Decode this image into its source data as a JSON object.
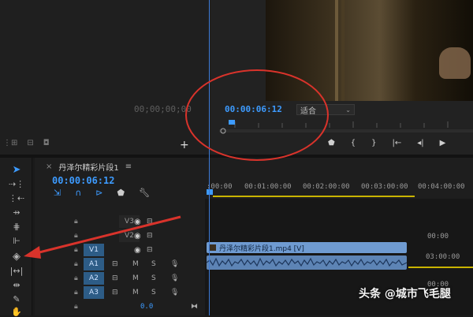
{
  "source": {
    "timecode": "00;00;00;00"
  },
  "program": {
    "timecode": "00:00:06:12",
    "fit_label": "适合"
  },
  "timeline": {
    "sequence_name": "丹泽尔精彩片段1",
    "timecode": "00:00:06:12",
    "ruler_labels": [
      ":00:00",
      "00:01:00:00",
      "00:02:00:00",
      "00:03:00:00",
      "00:04:00:00"
    ],
    "tracks": [
      {
        "name": "V3",
        "type": "video"
      },
      {
        "name": "V2",
        "type": "video"
      },
      {
        "name": "V1",
        "type": "video"
      },
      {
        "name": "A1",
        "type": "audio"
      },
      {
        "name": "A2",
        "type": "audio"
      },
      {
        "name": "A3",
        "type": "audio"
      }
    ],
    "clip_label": "丹泽尔精彩片段1.mp4 [V]",
    "master_volume": "0.0",
    "side_labels": [
      "00:00",
      "03:00:00",
      "00:00"
    ]
  },
  "watermark": "头条 @城市飞毛腿",
  "colors": {
    "accent_blue": "#3d9bff",
    "clip_blue": "#6f9bd1",
    "annotation_red": "#d9332b",
    "yellow_bar": "#c9b400"
  }
}
